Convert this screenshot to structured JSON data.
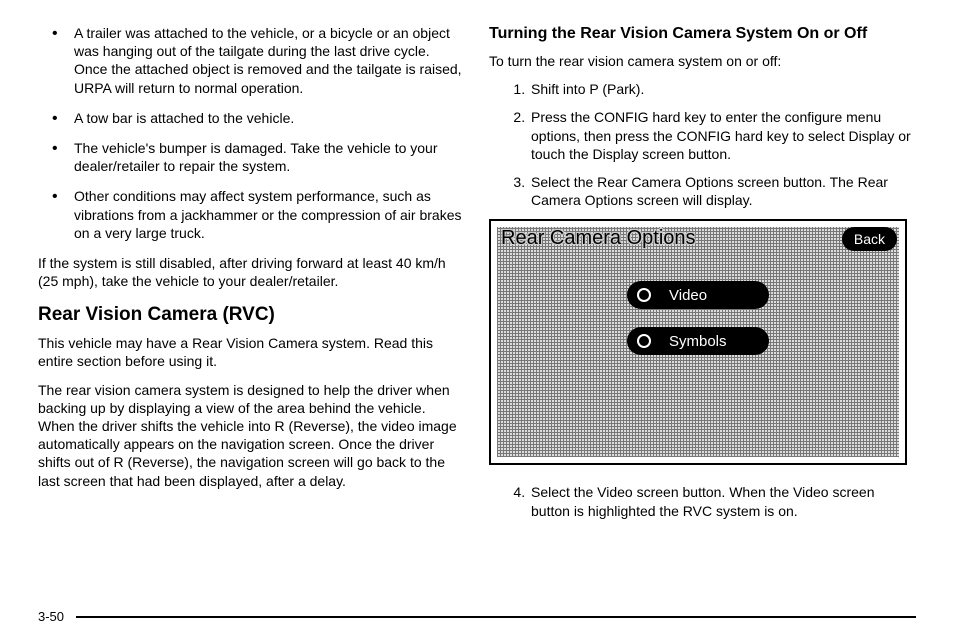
{
  "left": {
    "bullets": [
      "A trailer was attached to the vehicle, or a bicycle or an object was hanging out of the tailgate during the last drive cycle. Once the attached object is removed and the tailgate is raised, URPA will return to normal operation.",
      "A tow bar is attached to the vehicle.",
      "The vehicle's bumper is damaged. Take the vehicle to your dealer/retailer to repair the system.",
      "Other conditions may affect system performance, such as vibrations from a jackhammer or the compression of air brakes on a very large truck."
    ],
    "after_bullets": "If the system is still disabled, after driving forward at least 40 km/h (25 mph), take the vehicle to your dealer/retailer.",
    "h2": "Rear Vision Camera (RVC)",
    "p1": "This vehicle may have a Rear Vision Camera system. Read this entire section before using it.",
    "p2": "The rear vision camera system is designed to help the driver when backing up by displaying a view of the area behind the vehicle. When the driver shifts the vehicle into R (Reverse), the video image automatically appears on the navigation screen. Once the driver shifts out of R (Reverse), the navigation screen will go back to the last screen that had been displayed, after a delay."
  },
  "right": {
    "h3": "Turning the Rear Vision Camera System On or Off",
    "intro": "To turn the rear vision camera system on or off:",
    "steps_a": [
      "Shift into P (Park).",
      "Press the CONFIG hard key to enter the configure menu options, then press the CONFIG hard key to select Display or touch the Display screen button.",
      "Select the Rear Camera Options screen button. The Rear Camera Options screen will display."
    ],
    "screen": {
      "title": "Rear Camera Options",
      "back": "Back",
      "video": "Video",
      "symbols": "Symbols"
    },
    "steps_b": [
      "Select the Video screen button. When the Video screen button is highlighted the RVC system is on."
    ]
  },
  "page_number": "3-50"
}
